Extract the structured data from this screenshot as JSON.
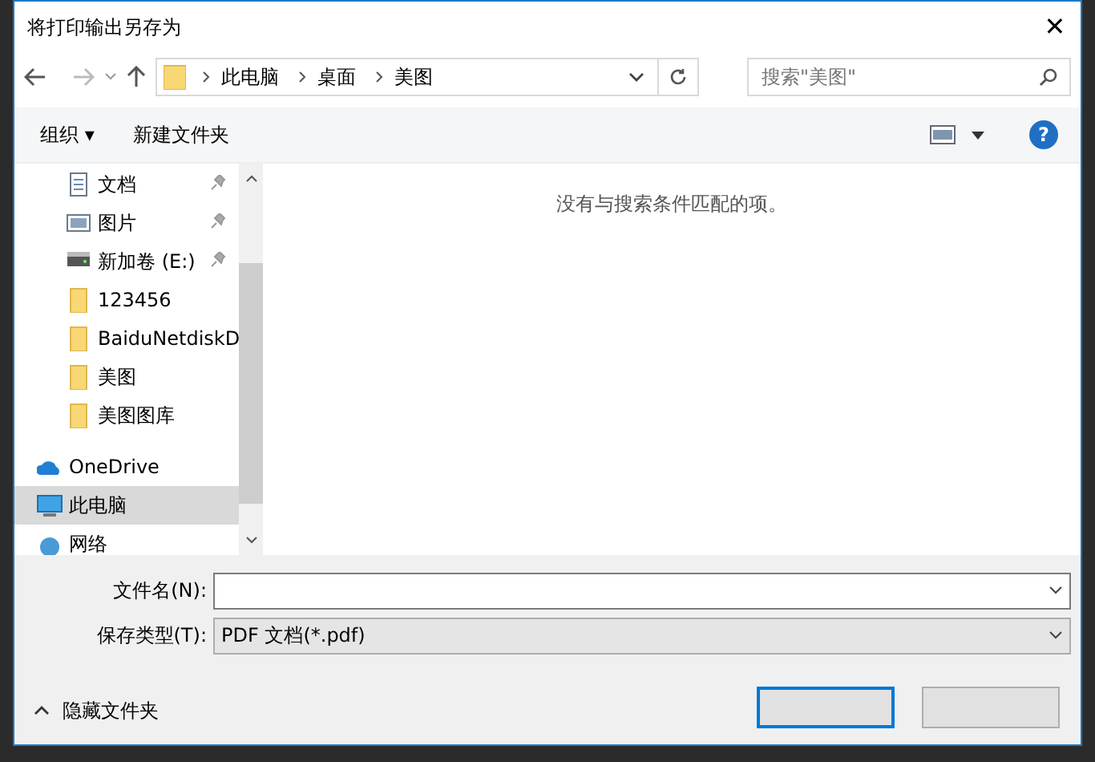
{
  "window": {
    "title": "将打印输出另存为",
    "close": "✕"
  },
  "address": {
    "path": [
      {
        "label": "此电脑"
      },
      {
        "label": "桌面"
      },
      {
        "label": "美图"
      }
    ],
    "search_placeholder": "搜索\"美图\""
  },
  "toolbar": {
    "organize": "组织 ▾",
    "new_folder": "新建文件夹",
    "help": "?"
  },
  "nav": [
    {
      "label": "文档",
      "kind": "docs",
      "pinned": true,
      "selected": false
    },
    {
      "label": "图片",
      "kind": "pictures",
      "pinned": true,
      "selected": false
    },
    {
      "label": "新加卷 (E:)",
      "kind": "drive",
      "pinned": true,
      "selected": false
    },
    {
      "label": "123456",
      "kind": "folder",
      "pinned": false,
      "selected": false
    },
    {
      "label": "BaiduNetdiskD",
      "kind": "folder",
      "pinned": false,
      "selected": false
    },
    {
      "label": "美图",
      "kind": "folder",
      "pinned": false,
      "selected": false
    },
    {
      "label": "美图图库",
      "kind": "folder",
      "pinned": false,
      "selected": false
    },
    {
      "label": "OneDrive",
      "kind": "cloud",
      "pinned": false,
      "selected": false
    },
    {
      "label": "此电脑",
      "kind": "pc",
      "pinned": false,
      "selected": true
    },
    {
      "label": "网络",
      "kind": "network",
      "pinned": false,
      "selected": false
    }
  ],
  "content": {
    "empty_message": "没有与搜索条件匹配的项。"
  },
  "form": {
    "filename_label": "文件名(N):",
    "type_label": "保存类型(T):",
    "type_value": "PDF 文档(*.pdf)"
  },
  "footer": {
    "hide_folders": "隐藏文件夹"
  }
}
